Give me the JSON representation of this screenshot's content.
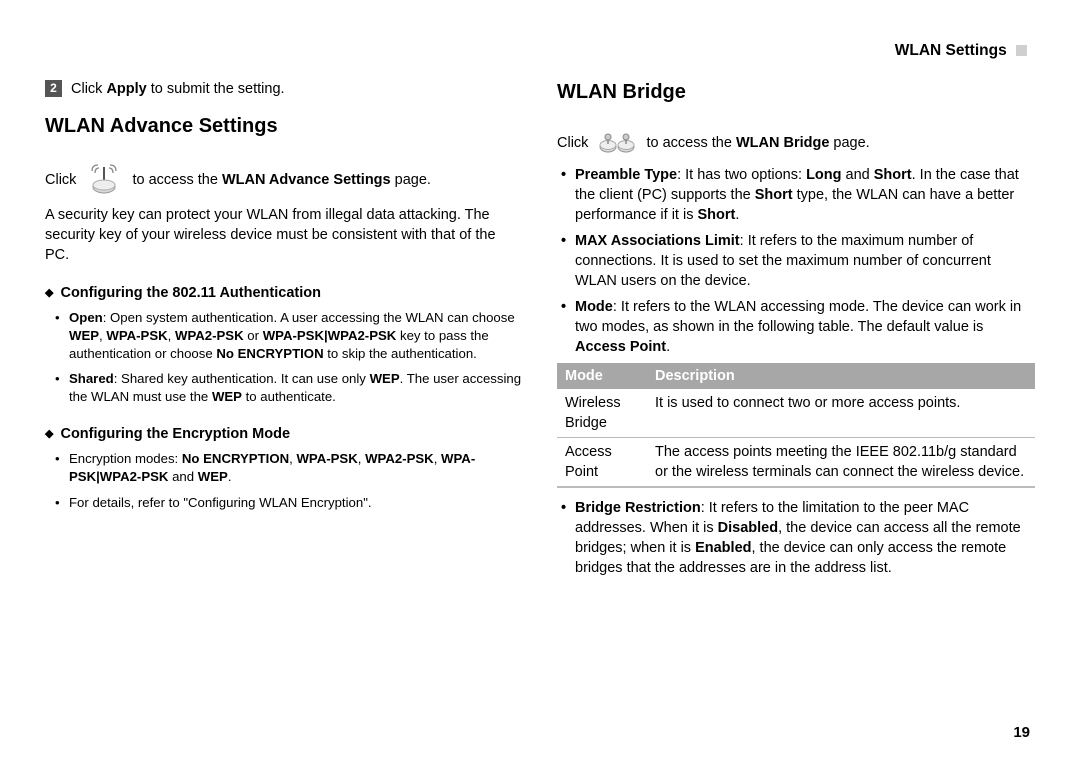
{
  "header": {
    "title": "WLAN Settings"
  },
  "left": {
    "step_num": "2",
    "step_text_prefix": "Click ",
    "step_text_bold": "Apply",
    "step_text_suffix": " to submit the setting.",
    "h2": "WLAN Advance Settings",
    "click_prefix": "Click",
    "click_mid": " to access the ",
    "click_bold": "WLAN Advance Settings",
    "click_suffix": " page.",
    "para1": "A security key can protect your WLAN from illegal data attacking. The security key of your wireless device must be consistent with that of the PC.",
    "sec1_h": "Configuring the 802.11 Authentication",
    "sec1_b1_a": "Open",
    "sec1_b1_b": ": Open system authentication. A user accessing the WLAN can choose ",
    "sec1_b1_c": "WEP",
    "sec1_b1_d": ", ",
    "sec1_b1_e": "WPA-PSK",
    "sec1_b1_f": ", ",
    "sec1_b1_g": "WPA2-PSK",
    "sec1_b1_h": " or ",
    "sec1_b1_i": "WPA-PSK|WPA2-PSK",
    "sec1_b1_j": " key to pass the authentication or choose ",
    "sec1_b1_k": "No ENCRYPTION",
    "sec1_b1_l": " to skip the authentication.",
    "sec1_b2_a": "Shared",
    "sec1_b2_b": ": Shared key authentication. It can use only ",
    "sec1_b2_c": "WEP",
    "sec1_b2_d": ". The user accessing the WLAN must use the ",
    "sec1_b2_e": "WEP",
    "sec1_b2_f": " to authenticate.",
    "sec2_h": "Configuring the Encryption Mode",
    "sec2_b1_a": "Encryption modes: ",
    "sec2_b1_b": "No ENCRYPTION",
    "sec2_b1_c": ", ",
    "sec2_b1_d": "WPA-PSK",
    "sec2_b1_e": ", ",
    "sec2_b1_f": "WPA2-PSK",
    "sec2_b1_g": ", ",
    "sec2_b1_h": "WPA-PSK|WPA2-PSK",
    "sec2_b1_i": " and ",
    "sec2_b1_j": "WEP",
    "sec2_b1_k": ".",
    "sec2_b2": "For details, refer to \"Configuring WLAN Encryption\"."
  },
  "right": {
    "h2": "WLAN Bridge",
    "click_prefix": "Click",
    "click_mid": " to access the ",
    "click_bold": "WLAN Bridge",
    "click_suffix": " page.",
    "b1_a": "Preamble Type",
    "b1_b": ": It has two options: ",
    "b1_c": "Long",
    "b1_d": " and ",
    "b1_e": "Short",
    "b1_f": ". In the case that the client (PC) supports the ",
    "b1_g": "Short",
    "b1_h": " type, the WLAN can have a better performance if it is ",
    "b1_i": "Short",
    "b1_j": ".",
    "b2_a": "MAX Associations Limit",
    "b2_b": ": It refers to the maximum number of connections. It is used to set the maximum number of concurrent WLAN users on the device.",
    "b3_a": "Mode",
    "b3_b": ": It refers to the WLAN accessing mode. The device can work in two modes, as shown in the following table. The default value is ",
    "b3_c": "Access Point",
    "b3_d": ".",
    "table": {
      "h1": "Mode",
      "h2": "Description",
      "r1c1": "Wireless Bridge",
      "r1c2": "It is used to connect two or more access points.",
      "r2c1": "Access Point",
      "r2c2": "The access points meeting the IEEE 802.11b/g standard or the wireless terminals can connect the wireless device."
    },
    "b4_a": "Bridge Restriction",
    "b4_b": ": It refers to the limitation to the peer MAC addresses. When it is ",
    "b4_c": "Disabled",
    "b4_d": ", the device can access all the remote bridges; when it is ",
    "b4_e": "Enabled",
    "b4_f": ", the device can only access the remote bridges that the addresses are in the address list."
  },
  "page_num": "19"
}
